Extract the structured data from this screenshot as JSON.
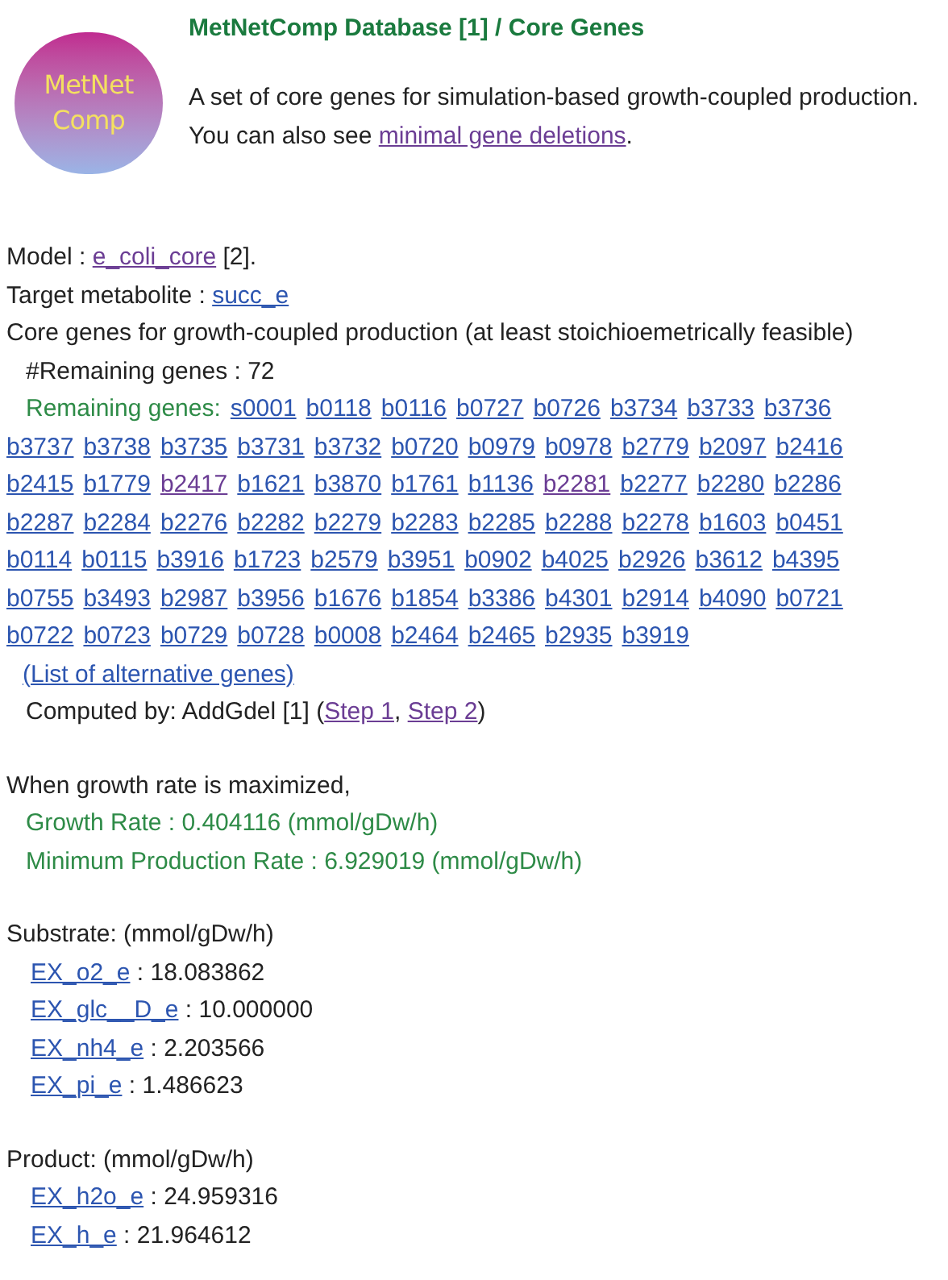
{
  "header": {
    "title": "MetNetComp Database [1] / Core Genes",
    "logo_text": [
      "MetNet",
      "Comp"
    ],
    "description": "A set of core genes for simulation-based growth-coupled production. You can also see ",
    "description_link": {
      "text": "minimal gene deletions",
      "visited": true
    },
    "description_end": "."
  },
  "model": {
    "label": "Model : ",
    "link": {
      "text": "e_coli_core",
      "visited": true
    },
    "suffix": " [2]."
  },
  "target": {
    "label": "Target metabolite : ",
    "link": {
      "text": "succ_e",
      "visited": false
    }
  },
  "core_heading": "Core genes for growth-coupled production (at least stoichioemetrically feasible)",
  "remaining_count": "#Remaining genes : 72",
  "remaining_genes": {
    "label": "Remaining genes:",
    "genes": [
      {
        "text": "s0001",
        "visited": false
      },
      {
        "text": "b0118",
        "visited": false
      },
      {
        "text": "b0116",
        "visited": false
      },
      {
        "text": "b0727",
        "visited": false
      },
      {
        "text": "b0726",
        "visited": false
      },
      {
        "text": "b3734",
        "visited": false
      },
      {
        "text": "b3733",
        "visited": false
      },
      {
        "text": "b3736",
        "visited": false
      },
      {
        "text": "b3737",
        "visited": false
      },
      {
        "text": "b3738",
        "visited": false
      },
      {
        "text": "b3735",
        "visited": false
      },
      {
        "text": "b3731",
        "visited": false
      },
      {
        "text": "b3732",
        "visited": false
      },
      {
        "text": "b0720",
        "visited": false
      },
      {
        "text": "b0979",
        "visited": false
      },
      {
        "text": "b0978",
        "visited": false
      },
      {
        "text": "b2779",
        "visited": false
      },
      {
        "text": "b2097",
        "visited": false
      },
      {
        "text": "b2416",
        "visited": false
      },
      {
        "text": "b2415",
        "visited": false
      },
      {
        "text": "b1779",
        "visited": false
      },
      {
        "text": "b2417",
        "visited": true
      },
      {
        "text": "b1621",
        "visited": false
      },
      {
        "text": "b3870",
        "visited": false
      },
      {
        "text": "b1761",
        "visited": false
      },
      {
        "text": "b1136",
        "visited": false
      },
      {
        "text": "b2281",
        "visited": true
      },
      {
        "text": "b2277",
        "visited": false
      },
      {
        "text": "b2280",
        "visited": false
      },
      {
        "text": "b2286",
        "visited": false
      },
      {
        "text": "b2287",
        "visited": false
      },
      {
        "text": "b2284",
        "visited": false
      },
      {
        "text": "b2276",
        "visited": false
      },
      {
        "text": "b2282",
        "visited": false
      },
      {
        "text": "b2279",
        "visited": false
      },
      {
        "text": "b2283",
        "visited": false
      },
      {
        "text": "b2285",
        "visited": false
      },
      {
        "text": "b2288",
        "visited": false
      },
      {
        "text": "b2278",
        "visited": false
      },
      {
        "text": "b1603",
        "visited": false
      },
      {
        "text": "b0451",
        "visited": false
      },
      {
        "text": "b0114",
        "visited": false
      },
      {
        "text": "b0115",
        "visited": false
      },
      {
        "text": "b3916",
        "visited": false
      },
      {
        "text": "b1723",
        "visited": false
      },
      {
        "text": "b2579",
        "visited": false
      },
      {
        "text": "b3951",
        "visited": false
      },
      {
        "text": "b0902",
        "visited": false
      },
      {
        "text": "b4025",
        "visited": false
      },
      {
        "text": "b2926",
        "visited": false
      },
      {
        "text": "b3612",
        "visited": false
      },
      {
        "text": "b4395",
        "visited": false
      },
      {
        "text": "b0755",
        "visited": false
      },
      {
        "text": "b3493",
        "visited": false
      },
      {
        "text": "b2987",
        "visited": false
      },
      {
        "text": "b3956",
        "visited": false
      },
      {
        "text": "b1676",
        "visited": false
      },
      {
        "text": "b1854",
        "visited": false
      },
      {
        "text": "b3386",
        "visited": false
      },
      {
        "text": "b4301",
        "visited": false
      },
      {
        "text": "b2914",
        "visited": false
      },
      {
        "text": "b4090",
        "visited": false
      },
      {
        "text": "b0721",
        "visited": false
      },
      {
        "text": "b0722",
        "visited": false
      },
      {
        "text": "b0723",
        "visited": false
      },
      {
        "text": "b0729",
        "visited": false
      },
      {
        "text": "b0728",
        "visited": false
      },
      {
        "text": "b0008",
        "visited": false
      },
      {
        "text": "b2464",
        "visited": false
      },
      {
        "text": "b2465",
        "visited": false
      },
      {
        "text": "b2935",
        "visited": false
      },
      {
        "text": "b3919",
        "visited": false
      }
    ],
    "alt_link": {
      "text": "(List of alternative genes)",
      "visited": false
    }
  },
  "computed_by": {
    "text": "Computed by: AddGdel [1] (",
    "links": [
      {
        "text": "Step 1",
        "visited": true
      },
      {
        "text": "Step 2",
        "visited": true
      }
    ],
    "separator": ", ",
    "end": ")"
  },
  "maximized": {
    "heading": "When growth rate is maximized,",
    "growth_rate": "Growth Rate : 0.404116 (mmol/gDw/h)",
    "min_production_rate": "Minimum Production Rate : 6.929019 (mmol/gDw/h)"
  },
  "substrate": {
    "heading": "Substrate: (mmol/gDw/h)",
    "items": [
      {
        "name": "EX_o2_e",
        "value": " : 18.083862"
      },
      {
        "name": "EX_glc__D_e",
        "value": " : 10.000000"
      },
      {
        "name": "EX_nh4_e",
        "value": " : 2.203566"
      },
      {
        "name": "EX_pi_e",
        "value": " : 1.486623"
      }
    ]
  },
  "product": {
    "heading": "Product: (mmol/gDw/h)",
    "items": [
      {
        "name": "EX_h2o_e",
        "value": " : 24.959316"
      },
      {
        "name": "EX_h_e",
        "value": " : 21.964612"
      }
    ]
  }
}
